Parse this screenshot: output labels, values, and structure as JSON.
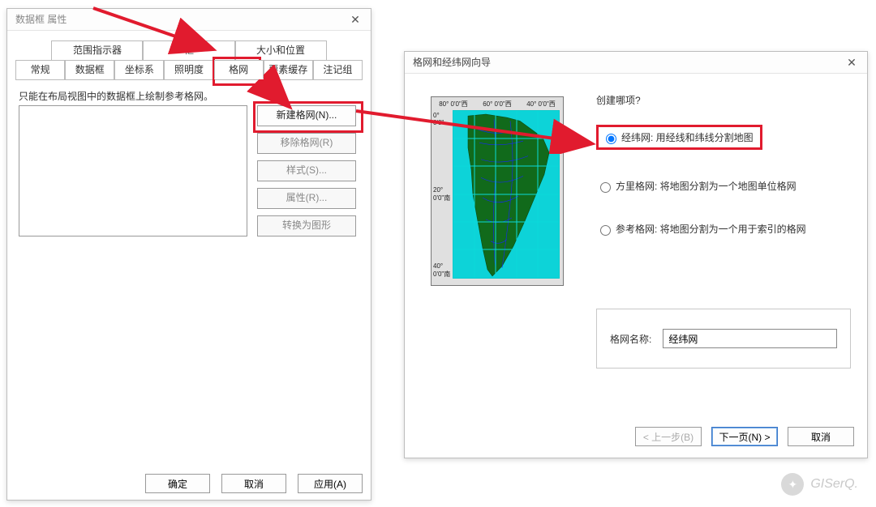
{
  "leftDialog": {
    "title": "数据框 属性",
    "tabsTop": [
      "范围指示器",
      "框",
      "大小和位置"
    ],
    "tabsBottom": [
      "常规",
      "数据框",
      "坐标系",
      "照明度",
      "格网",
      "要素缓存",
      "注记组"
    ],
    "activeTab": "格网",
    "msg": "只能在布局视图中的数据框上绘制参考格网。",
    "buttons": {
      "new": "新建格网(N)...",
      "remove": "移除格网(R)",
      "style": "样式(S)...",
      "props": "属性(R)...",
      "convert": "转换为图形"
    },
    "bottom": {
      "ok": "确定",
      "cancel": "取消",
      "apply": "应用(A)"
    }
  },
  "rightDialog": {
    "title": "格网和经纬网向导",
    "question": "创建哪项?",
    "radios": {
      "r1": "经纬网: 用经线和纬线分割地图",
      "r2": "方里格网: 将地图分割为一个地图单位格网",
      "r3": "参考格网: 将地图分割为一个用于索引的格网"
    },
    "mapTop": [
      "80° 0'0\"西",
      "60° 0'0\"西",
      "40° 0'0\"西"
    ],
    "mapLeft": [
      "0° 0'0\"",
      "20° 0'0\"南",
      "40° 0'0\"南"
    ],
    "nameLabel": "格网名称:",
    "nameValue": "经纬网",
    "bottom": {
      "back": "< 上一步(B)",
      "next": "下一页(N) >",
      "cancel": "取消"
    }
  },
  "watermark": "GISerQ."
}
